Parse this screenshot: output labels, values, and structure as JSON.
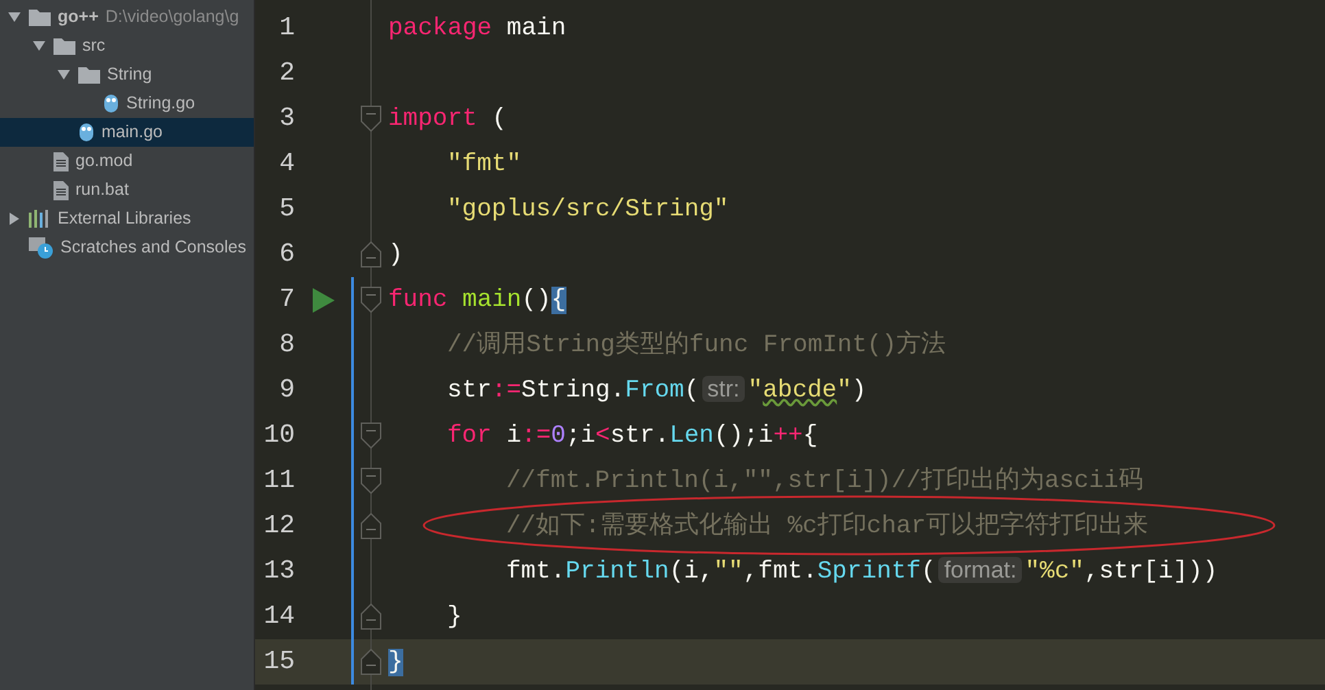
{
  "project_tree": [
    {
      "label": "go++",
      "path": "D:\\video\\golang\\g",
      "kind": "folder",
      "expanded": true,
      "selected": false,
      "children": [
        {
          "label": "src",
          "kind": "folder",
          "expanded": true,
          "selected": false,
          "children": [
            {
              "label": "String",
              "kind": "folder",
              "expanded": true,
              "selected": false,
              "children": [
                {
                  "label": "String.go",
                  "kind": "go-file",
                  "selected": false
                }
              ]
            },
            {
              "label": "main.go",
              "kind": "go-file",
              "selected": true
            }
          ]
        },
        {
          "label": "go.mod",
          "kind": "file",
          "selected": false
        },
        {
          "label": "run.bat",
          "kind": "file",
          "selected": false
        }
      ]
    },
    {
      "label": "External Libraries",
      "kind": "library",
      "expanded": false,
      "selected": false
    },
    {
      "label": "Scratches and Consoles",
      "kind": "scratches",
      "selected": false
    }
  ],
  "editor": {
    "lines": [
      {
        "number": "1",
        "modified": false,
        "run": false,
        "current": false,
        "tokens": [
          {
            "t": "package",
            "kind": "kw"
          },
          {
            "t": " main",
            "kind": "plain"
          }
        ]
      },
      {
        "number": "2",
        "modified": false,
        "run": false,
        "current": false
      },
      {
        "number": "3",
        "fold_marker": {
          "kind": "open"
        },
        "modified": false,
        "run": false,
        "current": false,
        "tokens": [
          {
            "t": "import",
            "kind": "kw"
          },
          {
            "t": " (",
            "kind": "plain"
          }
        ]
      },
      {
        "number": "4",
        "indent": {
          "kind": "single"
        },
        "modified": false,
        "run": false,
        "current": false,
        "tokens": [
          {
            "t": "\"fmt\"",
            "kind": "str"
          }
        ]
      },
      {
        "number": "5",
        "indent": {
          "kind": "single"
        },
        "modified": false,
        "run": false,
        "current": false,
        "tokens": [
          {
            "t": "\"goplus/src/String\"",
            "kind": "str"
          }
        ]
      },
      {
        "number": "6",
        "fold_marker": {
          "kind": "close"
        },
        "modified": false,
        "run": false,
        "current": false,
        "tokens": [
          {
            "t": ")",
            "kind": "plain"
          }
        ]
      },
      {
        "number": "7",
        "fold_marker": {
          "kind": "open"
        },
        "modified": true,
        "run": true,
        "current": false,
        "tokens": [
          {
            "t": "func ",
            "kind": "kw"
          },
          {
            "t": "main",
            "kind": "decl"
          },
          {
            "t": "()",
            "kind": "plain"
          },
          {
            "t": "{",
            "kind": "brace-match"
          }
        ]
      },
      {
        "number": "8",
        "indent": {
          "kind": "single"
        },
        "modified": true,
        "run": false,
        "current": false,
        "tokens": [
          {
            "t": "//调用String类型的func FromInt()方法",
            "kind": "comment"
          }
        ]
      },
      {
        "number": "9",
        "indent": {
          "kind": "single"
        },
        "modified": true,
        "run": false,
        "current": false,
        "tokens": [
          {
            "t": "str",
            "kind": "plain"
          },
          {
            "t": ":=",
            "kind": "op"
          },
          {
            "t": "String.",
            "kind": "plain"
          },
          {
            "t": "From",
            "kind": "call"
          },
          {
            "t": "(",
            "kind": "plain"
          },
          {
            "t": "str:",
            "kind": "hint"
          },
          {
            "t": "\"",
            "kind": "str"
          },
          {
            "t": "abcde",
            "kind": "str-typo"
          },
          {
            "t": "\"",
            "kind": "str"
          },
          {
            "t": ")",
            "kind": "plain"
          }
        ]
      },
      {
        "number": "10",
        "indent": {
          "kind": "single"
        },
        "fold_marker": {
          "kind": "open"
        },
        "modified": true,
        "run": false,
        "current": false,
        "tokens": [
          {
            "t": "for",
            "kind": "kw"
          },
          {
            "t": " i",
            "kind": "plain"
          },
          {
            "t": ":=",
            "kind": "op"
          },
          {
            "t": "0",
            "kind": "num"
          },
          {
            "t": ";i",
            "kind": "plain"
          },
          {
            "t": "<",
            "kind": "op"
          },
          {
            "t": "str.",
            "kind": "plain"
          },
          {
            "t": "Len",
            "kind": "call"
          },
          {
            "t": "();i",
            "kind": "plain"
          },
          {
            "t": "++",
            "kind": "op"
          },
          {
            "t": "{",
            "kind": "plain"
          }
        ]
      },
      {
        "number": "11",
        "indent": {
          "kind": "double"
        },
        "fold_marker": {
          "kind": "open"
        },
        "modified": true,
        "run": false,
        "current": false,
        "tokens": [
          {
            "t": "//fmt.Println(i,\"\",str[i])//打印出的为ascii码",
            "kind": "comment"
          }
        ]
      },
      {
        "number": "12",
        "indent": {
          "kind": "double"
        },
        "fold_marker": {
          "kind": "close"
        },
        "modified": true,
        "run": false,
        "current": false,
        "tokens": [
          {
            "t": "//如下:需要格式化输出 %c打印char可以把字符打印出来",
            "kind": "comment"
          }
        ]
      },
      {
        "number": "13",
        "indent": {
          "kind": "double"
        },
        "modified": true,
        "run": false,
        "current": false,
        "tokens": [
          {
            "t": "fmt.",
            "kind": "plain"
          },
          {
            "t": "Println",
            "kind": "call"
          },
          {
            "t": "(i,",
            "kind": "plain"
          },
          {
            "t": "\"\"",
            "kind": "str"
          },
          {
            "t": ",fmt.",
            "kind": "plain"
          },
          {
            "t": "Sprintf",
            "kind": "call"
          },
          {
            "t": "(",
            "kind": "plain"
          },
          {
            "t": "format:",
            "kind": "hint"
          },
          {
            "t": "\"%c\"",
            "kind": "str"
          },
          {
            "t": ",str[i]))",
            "kind": "plain"
          }
        ]
      },
      {
        "number": "14",
        "indent": {
          "kind": "single"
        },
        "fold_marker": {
          "kind": "close"
        },
        "modified": true,
        "run": false,
        "current": false,
        "tokens": [
          {
            "t": "}",
            "kind": "plain"
          }
        ]
      },
      {
        "number": "15",
        "fold_marker": {
          "kind": "close"
        },
        "modified": true,
        "run": false,
        "current": true,
        "tokens": [
          {
            "t": "}",
            "kind": "brace-match"
          }
        ]
      }
    ]
  }
}
